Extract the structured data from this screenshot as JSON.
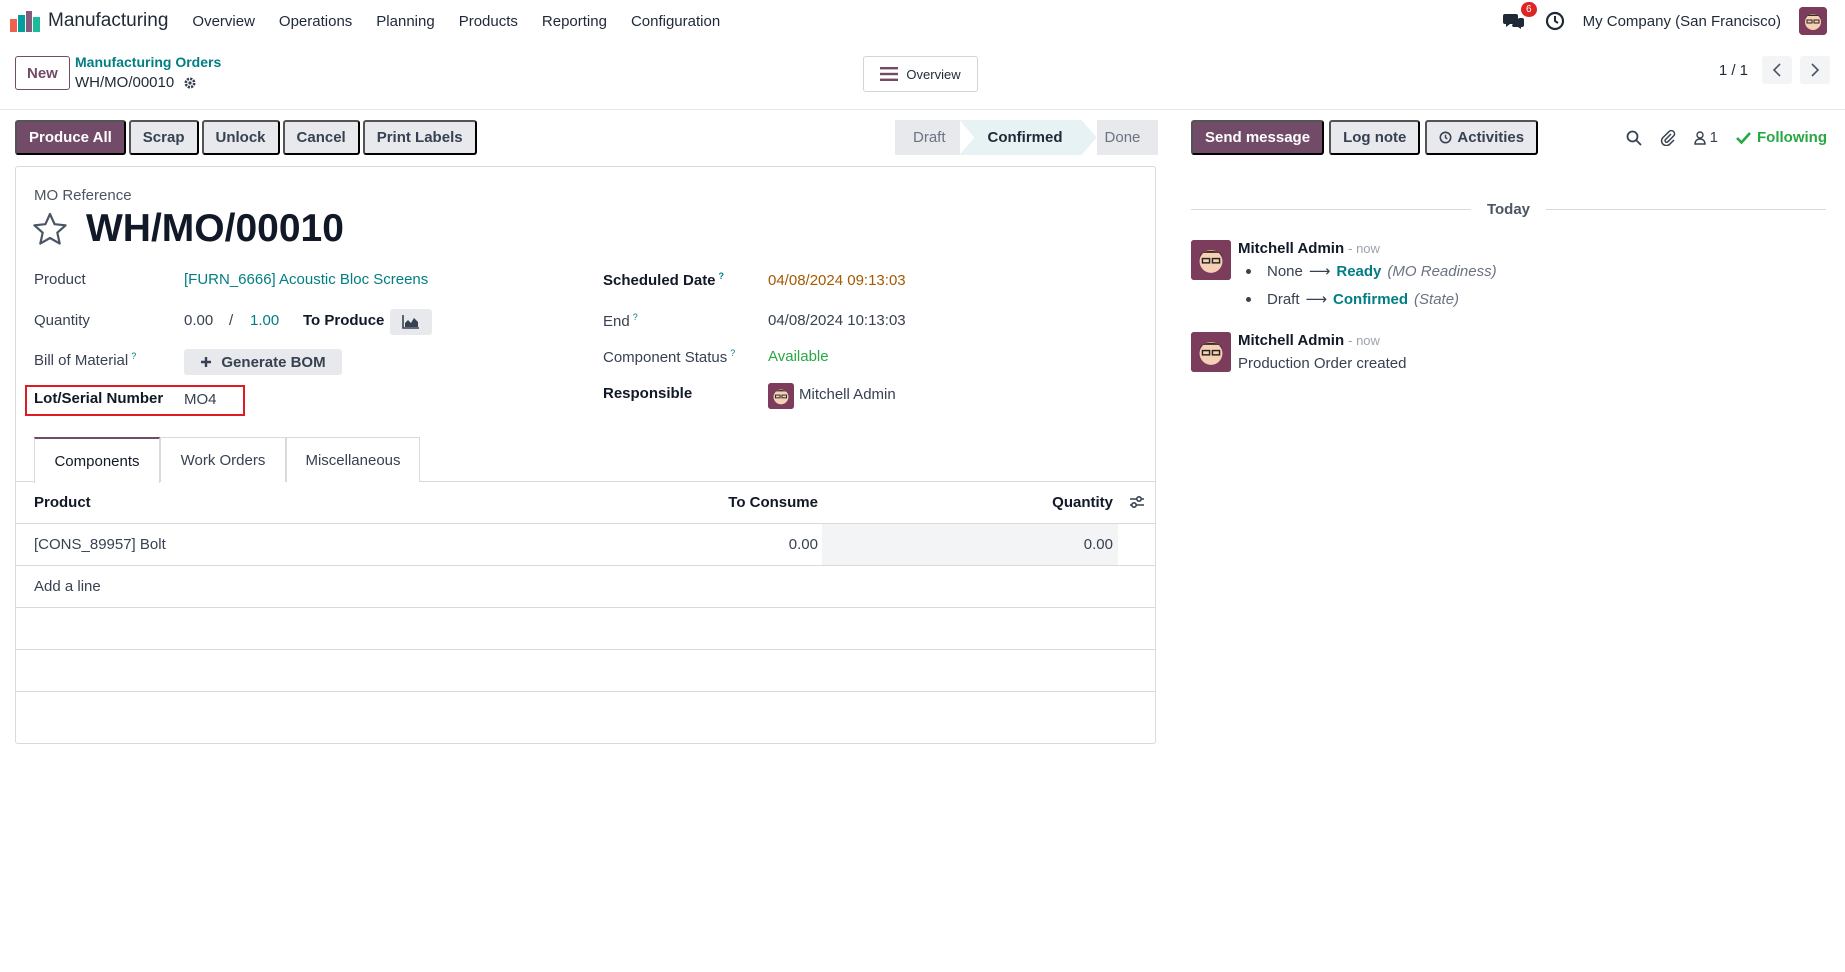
{
  "app": {
    "name": "Manufacturing",
    "menu": [
      "Overview",
      "Operations",
      "Planning",
      "Products",
      "Reporting",
      "Configuration"
    ],
    "messages_count": "6",
    "company": "My Company (San Francisco)"
  },
  "control": {
    "new_label": "New",
    "breadcrumb_parent": "Manufacturing Orders",
    "breadcrumb_current": "WH/MO/00010",
    "overview_label": "Overview",
    "pager": "1 / 1"
  },
  "actions": [
    "Produce All",
    "Scrap",
    "Unlock",
    "Cancel",
    "Print Labels"
  ],
  "stages": {
    "draft": "Draft",
    "confirmed": "Confirmed",
    "done": "Done",
    "current": "Confirmed"
  },
  "form": {
    "mo_reference_label": "MO Reference",
    "title": "WH/MO/00010",
    "product_label": "Product",
    "product_value": "[FURN_6666] Acoustic Bloc Screens",
    "quantity_label": "Quantity",
    "quantity_produced": "0.00",
    "quantity_separator": "/",
    "quantity_total": "1.00",
    "to_produce_label": "To Produce",
    "bom_label": "Bill of Material",
    "generate_bom_label": "Generate BOM",
    "lot_label": "Lot/Serial Number",
    "lot_value": "MO4",
    "scheduled_label": "Scheduled Date",
    "scheduled_value": "04/08/2024 09:13:03",
    "end_label": "End",
    "end_value": "04/08/2024 10:13:03",
    "component_status_label": "Component Status",
    "component_status_value": "Available",
    "responsible_label": "Responsible",
    "responsible_value": "Mitchell Admin",
    "help_mark": "?"
  },
  "tabs": [
    "Components",
    "Work Orders",
    "Miscellaneous"
  ],
  "components_table": {
    "headers": {
      "product": "Product",
      "to_consume": "To Consume",
      "quantity": "Quantity"
    },
    "rows": [
      {
        "product": "[CONS_89957] Bolt",
        "to_consume": "0.00",
        "quantity": "0.00"
      }
    ],
    "add_line": "Add a line"
  },
  "chatter": {
    "send_message": "Send message",
    "log_note": "Log note",
    "activities": "Activities",
    "followers_count": "1",
    "following": "Following",
    "date_separator": "Today",
    "messages": [
      {
        "author": "Mitchell Admin",
        "time": "- now",
        "tracking": [
          {
            "old": "None",
            "new": "Ready",
            "field": "(MO Readiness)"
          },
          {
            "old": "Draft",
            "new": "Confirmed",
            "field": "(State)"
          }
        ]
      },
      {
        "author": "Mitchell Admin",
        "time": "- now",
        "body": "Production Order created"
      }
    ]
  },
  "colors": {
    "brand": "#714b67",
    "link": "#017e84",
    "success": "#28a745",
    "warning": "#a35a00",
    "highlight": "#e01b24"
  },
  "icons": [
    "manufacturing-logo-icon",
    "chat-icon",
    "clock-icon",
    "gear-icon",
    "hamburger-icon",
    "chevron-left-icon",
    "chevron-right-icon",
    "star-icon",
    "area-chart-icon",
    "plus-icon",
    "optional-columns-icon",
    "search-icon",
    "paperclip-icon",
    "user-icon",
    "check-icon",
    "activity-clock-icon"
  ]
}
